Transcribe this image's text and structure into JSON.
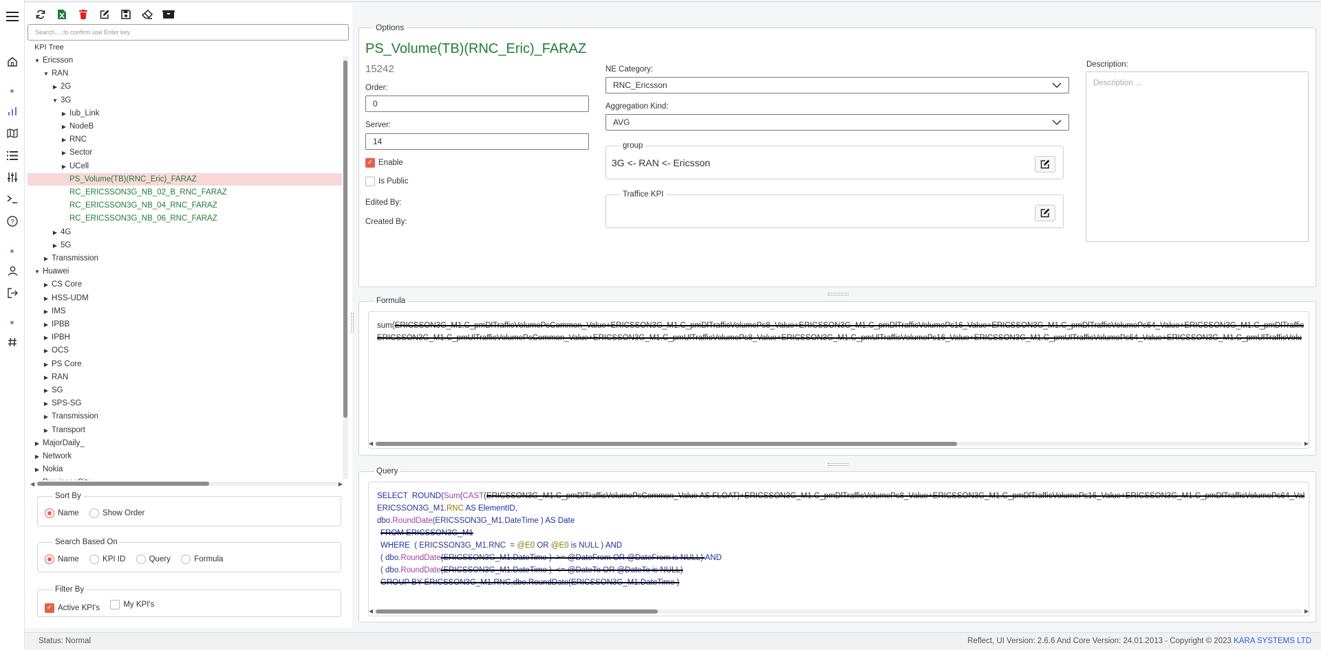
{
  "search": {
    "placeholder": "Search.....to confirm use Enter key"
  },
  "tree": {
    "title": "KPI Tree",
    "rows": [
      {
        "label": "Ericsson",
        "level": 0,
        "exp": "open"
      },
      {
        "label": "RAN",
        "level": 1,
        "exp": "open"
      },
      {
        "label": "2G",
        "level": 2,
        "exp": "closed"
      },
      {
        "label": "3G",
        "level": 2,
        "exp": "open"
      },
      {
        "label": "Iub_Link",
        "level": 3,
        "exp": "closed"
      },
      {
        "label": "NodeB",
        "level": 3,
        "exp": "closed"
      },
      {
        "label": "RNC",
        "level": 3,
        "exp": "closed"
      },
      {
        "label": "Sector",
        "level": 3,
        "exp": "closed"
      },
      {
        "label": "UCell",
        "level": 3,
        "exp": "closed"
      },
      {
        "label": "PS_Volume(TB)(RNC_Eric)_FARAZ",
        "level": 3,
        "exp": "leaf",
        "selected": true
      },
      {
        "label": "RC_ERICSSON3G_NB_02_B_RNC_FARAZ",
        "level": 3,
        "exp": "leaf"
      },
      {
        "label": "RC_ERICSSON3G_NB_04_RNC_FARAZ",
        "level": 3,
        "exp": "leaf"
      },
      {
        "label": "RC_ERICSSON3G_NB_06_RNC_FARAZ",
        "level": 3,
        "exp": "leaf"
      },
      {
        "label": "4G",
        "level": 2,
        "exp": "closed"
      },
      {
        "label": "5G",
        "level": 2,
        "exp": "closed"
      },
      {
        "label": "Transmission",
        "level": 1,
        "exp": "closed"
      },
      {
        "label": "Huawei",
        "level": 0,
        "exp": "open"
      },
      {
        "label": "CS Core",
        "level": 1,
        "exp": "closed"
      },
      {
        "label": "HSS-UDM",
        "level": 1,
        "exp": "closed"
      },
      {
        "label": "IMS",
        "level": 1,
        "exp": "closed"
      },
      {
        "label": "IPBB",
        "level": 1,
        "exp": "closed"
      },
      {
        "label": "IPBH",
        "level": 1,
        "exp": "closed"
      },
      {
        "label": "OCS",
        "level": 1,
        "exp": "closed"
      },
      {
        "label": "PS Core",
        "level": 1,
        "exp": "closed"
      },
      {
        "label": "RAN",
        "level": 1,
        "exp": "closed"
      },
      {
        "label": "SG",
        "level": 1,
        "exp": "closed"
      },
      {
        "label": "SPS-SG",
        "level": 1,
        "exp": "closed"
      },
      {
        "label": "Transmission",
        "level": 1,
        "exp": "closed"
      },
      {
        "label": "Transport",
        "level": 1,
        "exp": "closed"
      },
      {
        "label": "MajorDaily_",
        "level": 0,
        "exp": "closed"
      },
      {
        "label": "Network",
        "level": 0,
        "exp": "closed"
      },
      {
        "label": "Nokia",
        "level": 0,
        "exp": "closed"
      },
      {
        "label": "ProvincesCity",
        "level": 0,
        "exp": "closed"
      }
    ]
  },
  "sort_by": {
    "legend": "Sort By",
    "options": [
      "Name",
      "Show Order"
    ],
    "selected": "Name"
  },
  "search_based_on": {
    "legend": "Search Based On",
    "options": [
      "Name",
      "KPI ID",
      "Query",
      "Formula"
    ],
    "selected": "Name"
  },
  "filter_by": {
    "legend": "Filter By",
    "active": "Active KPI's",
    "mine": "My KPI's",
    "active_checked": true,
    "mine_checked": false
  },
  "options": {
    "legend": "Options",
    "kpi_name": "PS_Volume(TB)(RNC_Eric)_FARAZ",
    "kpi_id": "15242",
    "order_label": "Order:",
    "order_value": "0",
    "server_label": "Server:",
    "server_value": "14",
    "enable_label": "Enable",
    "enable_checked": true,
    "public_label": "Is Public",
    "public_checked": false,
    "edited_by_label": "Edited By:",
    "created_by_label": "Created By:",
    "ne_category_label": "NE Category:",
    "ne_category_value": "RNC_Ericsson",
    "aggregation_label": "Aggregation Kind:",
    "aggregation_value": "AVG",
    "group_legend": "group",
    "group_value": "3G <- RAN <- Ericsson",
    "traffic_legend": "Traffice KPI",
    "traffic_value": "",
    "description_label": "Description:",
    "description_placeholder": "Description ..."
  },
  "formula": {
    "legend": "Formula",
    "line1_a": "sum(",
    "line1_b": "ERICSSON3G_M1.C_pmDlTrafficVolumePsCommon_Value+ERICSSON3G_M1.C_pmDlTrafficVolumePs8_Value+ERICSSON3G_M1.C_pmDlTrafficVolumePs16_Value+ERICSSON3G_M1.C_pmDlTrafficVolumePs64_Value+ERICSSON3G_M1.C_pmDlTraffic",
    "line2": "ERICSSON3G_M1.C_pmUlTrafficVolumePsCommon_Value+ERICSSON3G_M1.C_pmUlTrafficVolumePs8_Value+ERICSSON3G_M1.C_pmUlTrafficVolumePs16_Value+ERICSSON3G_M1.C_pmUlTrafficVolumePs64_Value+ERICSSON3G_M1.C_pmUlTrafficVolu"
  },
  "query": {
    "legend": "Query",
    "l1_select": "SELECT",
    "l1_round": "ROUND",
    "l1_sum": "Sum",
    "l1_cast": "CAST",
    "l1_rest": "ERICSSON3G_M1.C_pmDlTrafficVolumePsCommon_Value AS FLOAT)+ERICSSON3G_M1.C_pmDlTrafficVolumePs8_Value+ERICSSON3G_M1.C_pmDlTrafficVolumePs16_Value+ERICSSON3G_M1.C_pmDlTrafficVolumePs64_Val",
    "l2_a": "ERICSSON3G_M1.",
    "l2_b": "RNC",
    "l2_c": " AS ElementID,",
    "l3_a": "dbo.",
    "l3_b": "RoundDate",
    "l3_c": "(ERICSSON3G_M1.DateTime ) ",
    "l3_d": "AS Date",
    "l4": "FROM ERICSSON3G_M1",
    "l5_a": "WHERE",
    "l5_b": "  ( ERICSSON3G_M1.RNC  = ",
    "l5_c": "@E0",
    "l5_d": " OR ",
    "l5_e": "@E0",
    "l5_f": " is NULL ) ",
    "l5_g": "AND",
    "l6_a": "( dbo.",
    "l6_b": "RoundDate",
    "l6_c": "(ERICSSON3G_M1.DateTime )  >= @DateFrom OR @DateFrom is NULL) ",
    "l6_d": "AND",
    "l7_a": "( dbo.",
    "l7_b": "RoundDate",
    "l7_c": "(ERICSSON3G_M1.DateTime )  <= @DateTo OR @DateTo is NULL)",
    "l8": "GROUP BY ERICSSON3G_M1.RNC,dbo.RoundDate(ERICSSON3G_M1.DateTime )"
  },
  "status": {
    "left": "Status: Normal",
    "right": "Reflect, UI Version: 2.6.6 And Core Version: 24.01.2013 - Copyright © 2023 ",
    "brand": "KARA SYSTEMS LTD"
  },
  "colors": {
    "accent": "#e8604c",
    "kpi_green": "#1e7e34",
    "selected_row": "#f8d7d7",
    "brand_link": "#2c5fd6"
  },
  "icons": {
    "toolbar": [
      "refresh-icon",
      "excel-export-icon",
      "delete-icon",
      "edit-icon",
      "save-icon",
      "eraser-icon",
      "package-icon"
    ],
    "rail": [
      "menu-icon",
      "home-icon",
      "chart-icon",
      "map-icon",
      "list-icon",
      "sliders-icon",
      "terminal-icon",
      "help-icon",
      "user-icon",
      "logout-icon",
      "hash-icon"
    ]
  }
}
